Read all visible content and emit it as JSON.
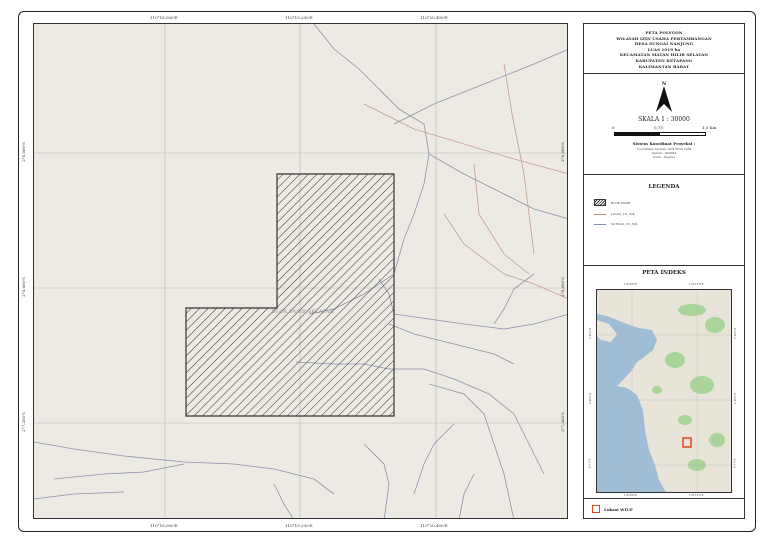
{
  "title_block": {
    "lines": [
      "PETA POLYGON",
      "WILAYAH IZIN USAHA PERTAMBANGAN",
      "DESA SUNGAI NANJUNG",
      "LUAS 1019 ha",
      "KECAMATAN MATAN HILIR SELATAN",
      "KABUPATEN KETAPANG",
      "KALIMANTAN BARAT"
    ]
  },
  "north_arrow": {
    "letter": "N",
    "icon": "north-arrow-icon"
  },
  "scale": {
    "text": "SKALA 1 : 30000",
    "labels": [
      "0",
      "0,75",
      "1,5 Km"
    ]
  },
  "crs": {
    "title": "Sistem Koordinat Proyeksi :",
    "lines": [
      "Coordinate System: GCS WGS 1984",
      "Datum : WGS84",
      "Units : Degree"
    ]
  },
  "legend": {
    "title": "LEGENDA",
    "items": [
      {
        "label": "BLOK PASIR",
        "kind": "hatch"
      },
      {
        "label": "JALAN_LN_50K",
        "kind": "road",
        "color": "#b48a80"
      },
      {
        "label": "SUNGAI_LN_50K",
        "kind": "river",
        "color": "#8090a8"
      }
    ]
  },
  "index_map": {
    "title": "PETA INDEKS",
    "top_ticks": [
      "110°0'0\"E",
      "110°12'0\"E"
    ],
    "bottom_ticks": [
      "110°0'0\"E",
      "110°12'0\"E"
    ],
    "left_ticks": [
      "1°36'0\"S",
      "1°48'0\"S",
      "2°0'0\"S"
    ],
    "right_ticks": [
      "1°36'0\"S",
      "1°48'0\"S",
      "2°0'0\"S"
    ],
    "location_label": "Lokasi WIUP",
    "location_color": "#e24a1a"
  },
  "main_map": {
    "top_ticks": [
      "110°18,000'E",
      "110°19,200'E",
      "110°20,400'E"
    ],
    "bottom_ticks": [
      "110°18,000'E",
      "110°19,200'E",
      "110°20,400'E"
    ],
    "left_ticks": [
      "2°6,000'S",
      "2°6,600'S",
      "2°7,200'S"
    ],
    "right_ticks": [
      "2°6,000'S",
      "2°6,600'S",
      "2°7,200'S"
    ],
    "polygon_label": "BLOK PASIR SELATAN",
    "colors": {
      "background": "#edeae3",
      "grid": "#b8b8b8",
      "river": "#8a94a8",
      "road": "#c39e94",
      "hatch": "#333333"
    }
  }
}
